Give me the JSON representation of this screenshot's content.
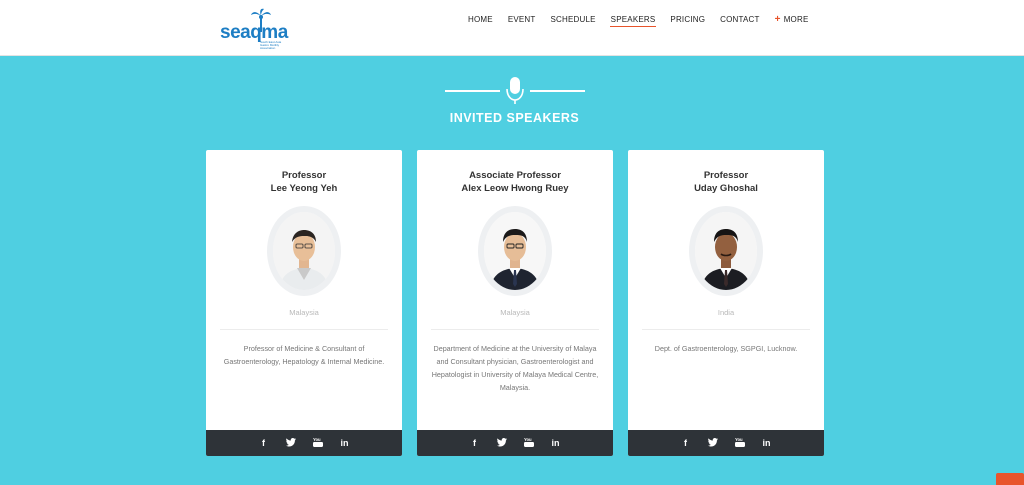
{
  "logo": {
    "text": "seaqma",
    "sub": "South East Asia Gastro Motility Association"
  },
  "nav": {
    "items": [
      "HOME",
      "EVENT",
      "SCHEDULE",
      "SPEAKERS",
      "PRICING",
      "CONTACT"
    ],
    "active": "SPEAKERS",
    "more_label": "MORE",
    "more_icon": "plus-icon"
  },
  "section": {
    "title": "INVITED SPEAKERS",
    "icon": "microphone-icon"
  },
  "speakers": [
    {
      "title": "Professor",
      "name": "Lee Yeong Yeh",
      "country": "Malaysia",
      "description": "Professor of Medicine & Consultant of Gastroenterology, Hepatology & Internal Medicine."
    },
    {
      "title": "Associate Professor",
      "name": "Alex Leow Hwong Ruey",
      "country": "Malaysia",
      "description": "Department of Medicine at the University of Malaya and Consultant physician, Gastroenterologist and Hepatologist in University of Malaya Medical Centre, Malaysia."
    },
    {
      "title": "Professor",
      "name": "Uday Ghoshal",
      "country": "India",
      "description": "Dept. of Gastroenterology, SGPGI, Lucknow."
    }
  ],
  "social_icons": {
    "facebook": "f",
    "twitter": "t",
    "youtube": "You",
    "linkedin": "in"
  },
  "colors": {
    "background": "#4fcfe1",
    "accent": "#e8542b",
    "footer_bar": "#2e3338",
    "brand": "#1d7ec4"
  }
}
